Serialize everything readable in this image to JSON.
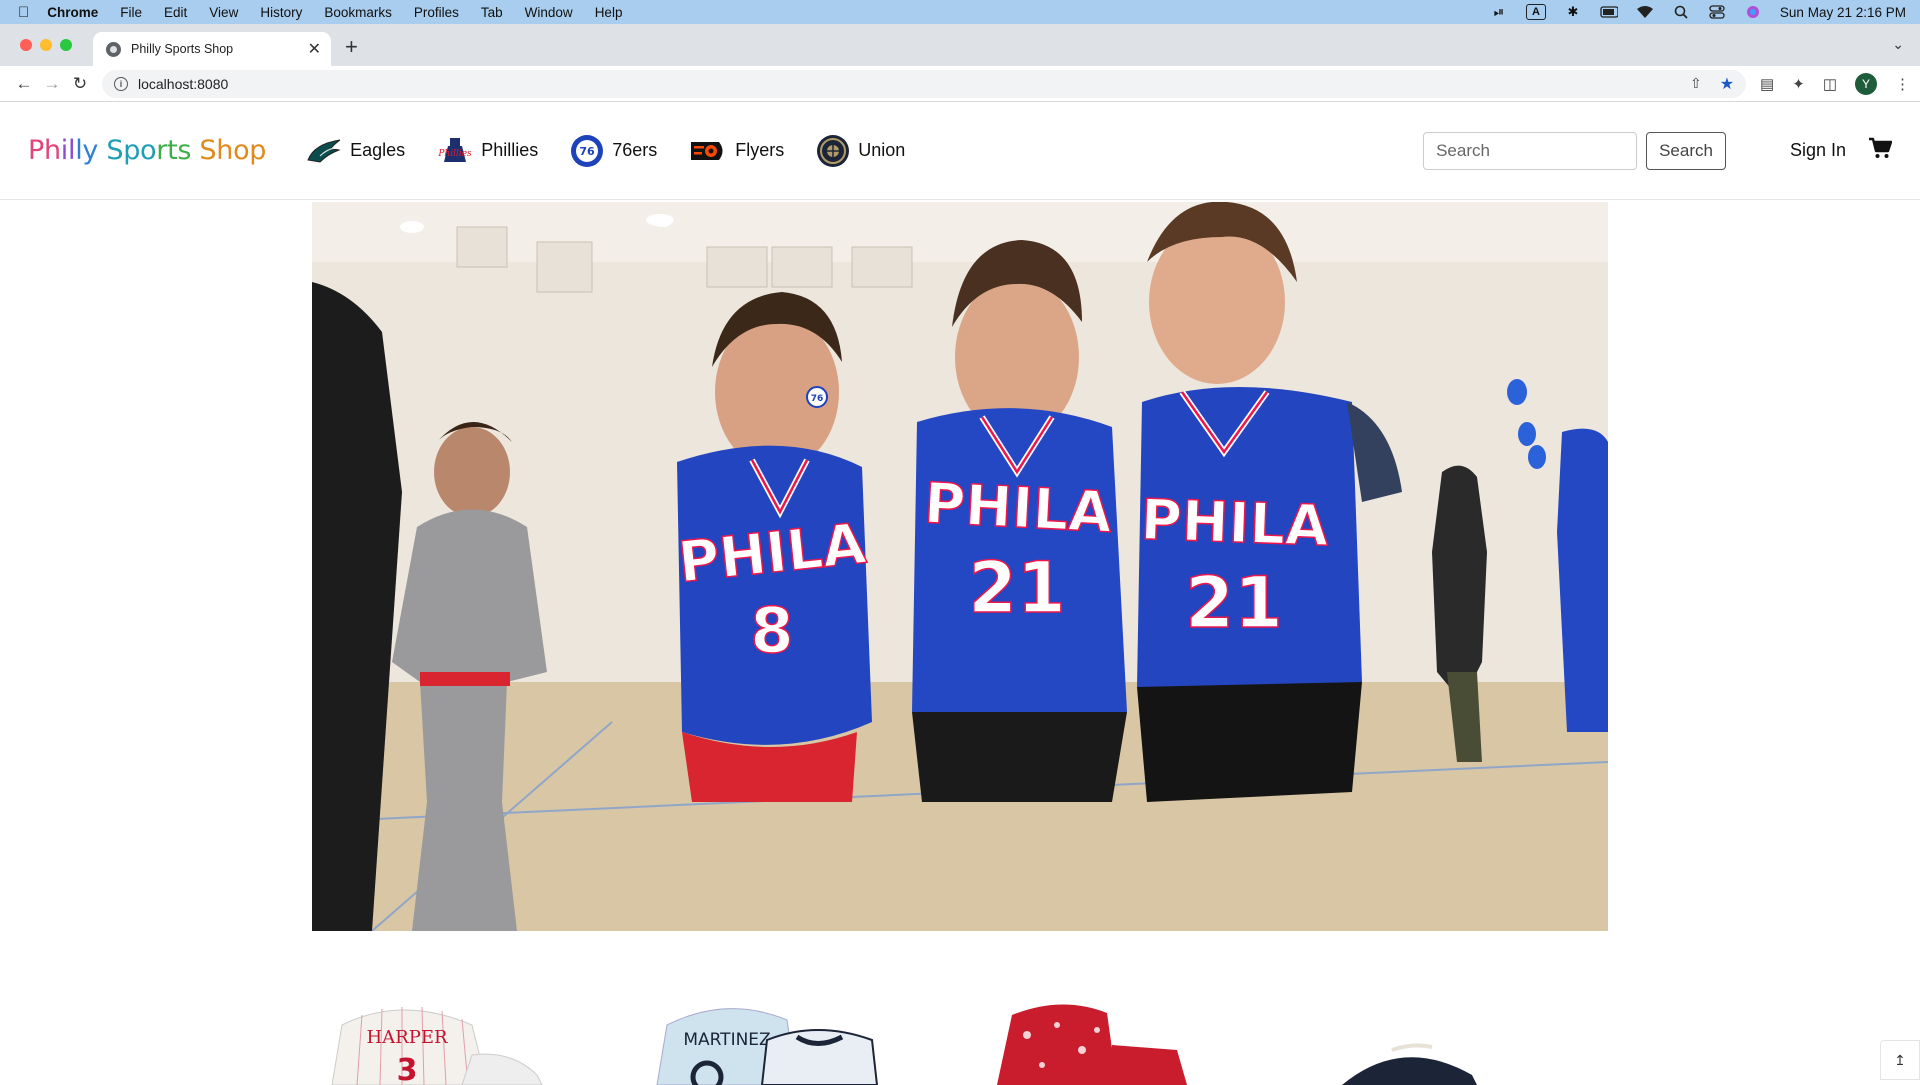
{
  "menubar": {
    "app": "Chrome",
    "items": [
      "File",
      "Edit",
      "View",
      "History",
      "Bookmarks",
      "Profiles",
      "Tab",
      "Window",
      "Help"
    ],
    "input_indicator": "A",
    "datetime": "Sun May 21  2:16 PM"
  },
  "browser": {
    "tab_title": "Philly Sports Shop",
    "url": "localhost:8080",
    "avatar_initial": "Y"
  },
  "site": {
    "brand": [
      "Ph",
      "il",
      "ly ",
      "Spo",
      "rts ",
      "Shop"
    ],
    "teams": [
      "Eagles",
      "Phillies",
      "76ers",
      "Flyers",
      "Union"
    ],
    "search_placeholder": "Search",
    "search_button": "Search",
    "signin": "Sign In"
  },
  "hero": {
    "jerseys": [
      {
        "text": "PHILA",
        "number": "8"
      },
      {
        "text": "PHILA",
        "number": "21"
      },
      {
        "text": "PHILA",
        "number": "21"
      }
    ],
    "cheek_logo": "76"
  },
  "products": [
    {
      "jersey_name": "HARPER"
    },
    {
      "jersey_name": "MARTINEZ"
    },
    {
      "jersey_name": ""
    },
    {
      "jersey_name": ""
    }
  ],
  "colors": {
    "menubar_bg": "#a8cdee",
    "sixers_blue": "#1d42ba",
    "sixers_red": "#ed174c"
  }
}
